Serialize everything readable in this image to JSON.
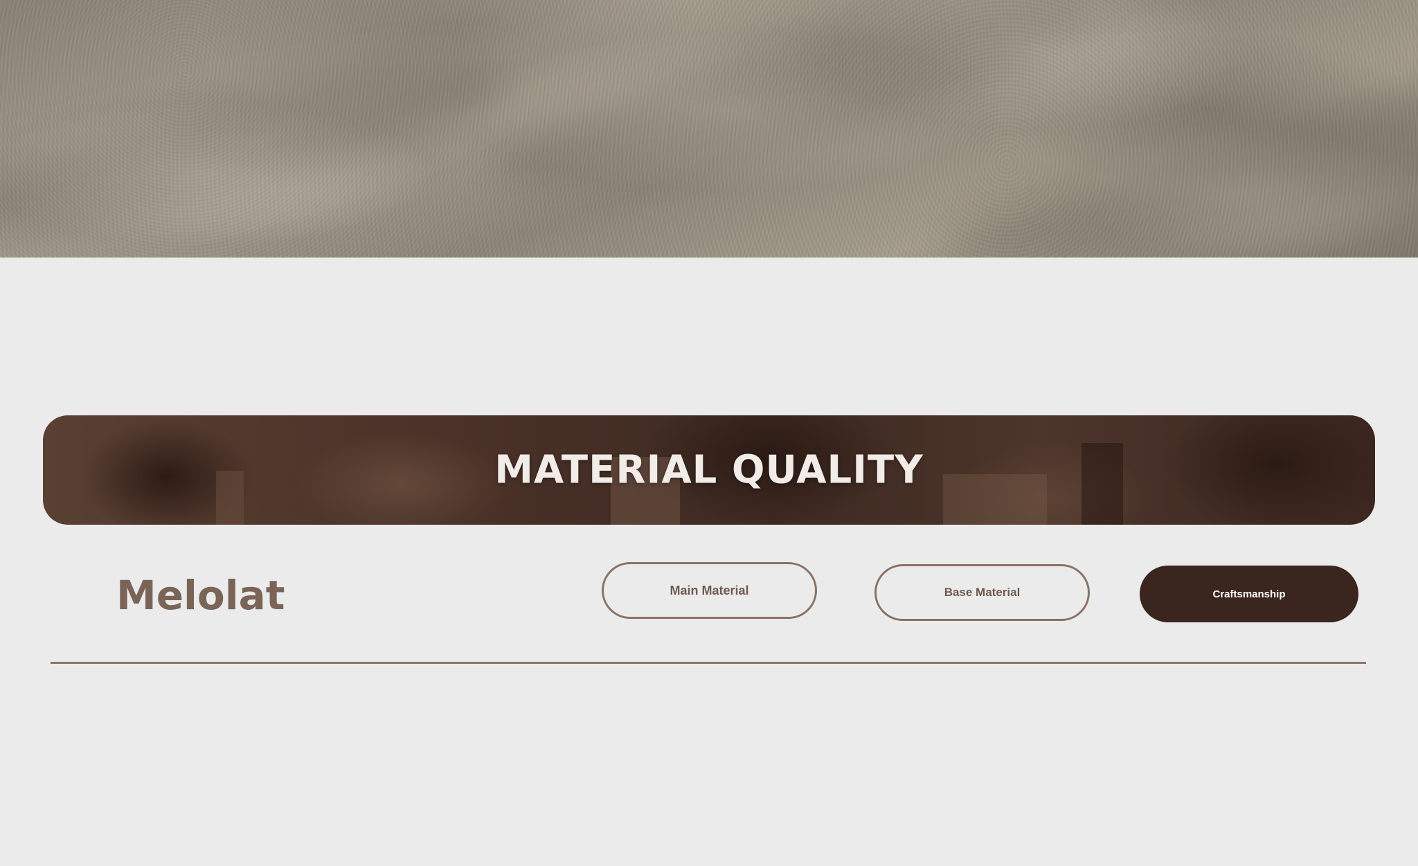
{
  "banner": {
    "title": "MATERIAL QUALITY"
  },
  "brand": {
    "name": "Melolat"
  },
  "tabs": [
    {
      "label": "Main Material",
      "state": "outline"
    },
    {
      "label": "Base Material",
      "state": "outline"
    },
    {
      "label": "Craftsmanship",
      "state": "selected"
    }
  ],
  "colors": {
    "page_background": "#ebebeb",
    "brand_text": "#7a6458",
    "outline_border": "#8a7265",
    "selected_fill": "#3b251f",
    "divider": "#8c7468"
  }
}
